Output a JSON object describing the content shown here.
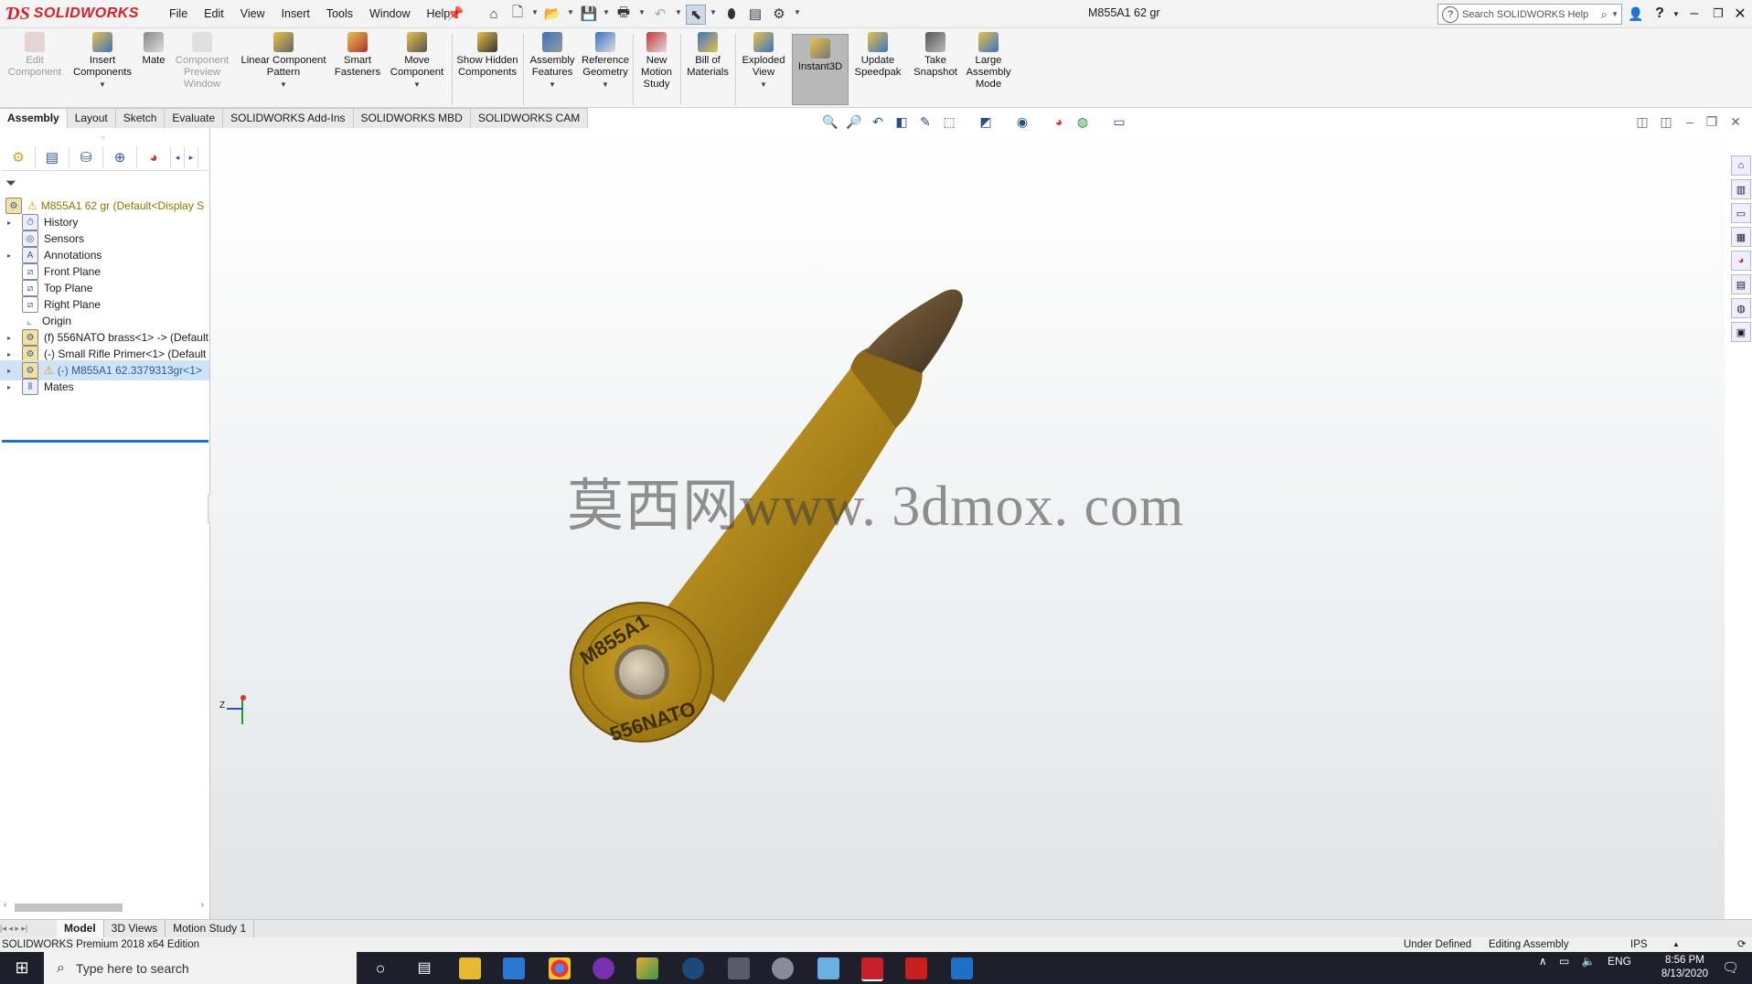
{
  "app": {
    "logo_text": "SOLIDWORKS",
    "document_title": "M855A1 62 gr",
    "menu": [
      "File",
      "Edit",
      "View",
      "Insert",
      "Tools",
      "Window",
      "Help"
    ],
    "search_placeholder": "Search SOLIDWORKS Help"
  },
  "toolbar": {
    "edit_component": "Edit Component",
    "insert_components": "Insert Components",
    "mate": "Mate",
    "component_preview": "Component Preview Window",
    "linear_pattern": "Linear Component Pattern",
    "smart_fasteners": "Smart Fasteners",
    "move_component": "Move Component",
    "show_hidden": "Show Hidden Components",
    "assembly_features": "Assembly Features",
    "reference_geometry": "Reference Geometry",
    "new_motion_study": "New Motion Study",
    "bill_of_materials": "Bill of Materials",
    "exploded_view": "Exploded View",
    "instant3d": "Instant3D",
    "update_speedpak": "Update Speedpak",
    "take_snapshot": "Take Snapshot",
    "large_assembly_mode": "Large Assembly Mode"
  },
  "command_tabs": [
    "Assembly",
    "Layout",
    "Sketch",
    "Evaluate",
    "SOLIDWORKS Add-Ins",
    "SOLIDWORKS MBD",
    "SOLIDWORKS CAM"
  ],
  "feature_tree": {
    "root": "M855A1 62 gr  (Default<Display S",
    "items": [
      {
        "label": "History"
      },
      {
        "label": "Sensors"
      },
      {
        "label": "Annotations"
      },
      {
        "label": "Front Plane"
      },
      {
        "label": "Top Plane"
      },
      {
        "label": "Right Plane"
      },
      {
        "label": "Origin"
      },
      {
        "label": "(f) 556NATO brass<1> -> (Default"
      },
      {
        "label": "(-) Small Rifle Primer<1> (Default"
      },
      {
        "label": "(-) M855A1 62.3379313gr<1>"
      },
      {
        "label": "Mates"
      }
    ]
  },
  "viewport": {
    "watermark": "莫西网www. 3dmox. com",
    "headstamp_top": "M855A1",
    "headstamp_bottom": "556NATO",
    "triad_label": "Z"
  },
  "bottom_tabs": [
    "Model",
    "3D Views",
    "Motion Study 1"
  ],
  "status": {
    "product": "SOLIDWORKS Premium 2018 x64 Edition",
    "definition": "Under Defined",
    "mode": "Editing Assembly",
    "units": "IPS"
  },
  "taskbar": {
    "search_placeholder": "Type here to search",
    "language": "ENG",
    "time": "8:56 PM",
    "date": "8/13/2020"
  },
  "colors": {
    "brass": "#a8841a",
    "tip": "#5a4a32",
    "solidworks_red": "#d71f26",
    "selection": "#cfe3f7"
  }
}
